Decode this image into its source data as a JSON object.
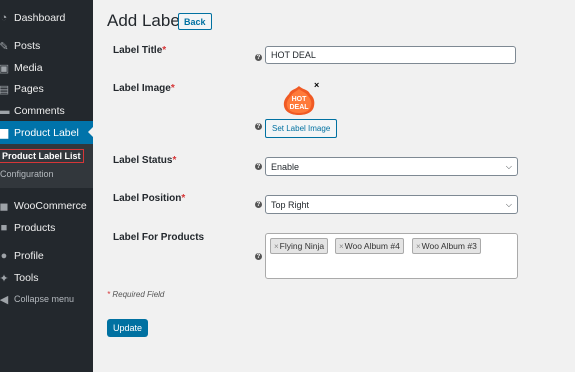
{
  "sidebar": {
    "items": [
      {
        "label": "Dashboard",
        "icon": "dashboard-icon"
      },
      {
        "label": "Posts",
        "icon": "pin-icon"
      },
      {
        "label": "Media",
        "icon": "media-icon"
      },
      {
        "label": "Pages",
        "icon": "page-icon"
      },
      {
        "label": "Comments",
        "icon": "comment-icon"
      },
      {
        "label": "Product Label",
        "icon": "image-icon"
      },
      {
        "label": "WooCommerce",
        "icon": "woo-icon"
      },
      {
        "label": "Products",
        "icon": "box-icon"
      },
      {
        "label": "Profile",
        "icon": "user-icon"
      },
      {
        "label": "Tools",
        "icon": "wrench-icon"
      },
      {
        "label": "Collapse menu",
        "icon": "collapse-icon"
      }
    ],
    "submenu": {
      "current": "Product Label List",
      "configuration": "Configuration"
    }
  },
  "page": {
    "title": "Add Label",
    "back_label": "Back"
  },
  "form": {
    "title": {
      "label": "Label Title",
      "required": "*",
      "value": "HOT DEAL"
    },
    "image": {
      "label": "Label Image",
      "required": "*",
      "image_text_1": "HOT",
      "image_text_2": "DEAL",
      "remove": "×",
      "button": "Set Label Image"
    },
    "status": {
      "label": "Label Status",
      "required": "*",
      "value": "Enable"
    },
    "position": {
      "label": "Label Position",
      "required": "*",
      "value": "Top Right"
    },
    "products": {
      "label": "Label For Products",
      "tags": [
        "Flying Ninja",
        "Woo Album #4",
        "Woo Album #3"
      ]
    },
    "help_glyph": "?",
    "tag_remove": "×",
    "required_note_star": "*",
    "required_note": " Required Field",
    "update_label": "Update"
  },
  "colors": {
    "sidebar_bg": "#23282d",
    "accent": "#0073aa",
    "required": "#d63638",
    "badge_orange": "#f05a24"
  }
}
